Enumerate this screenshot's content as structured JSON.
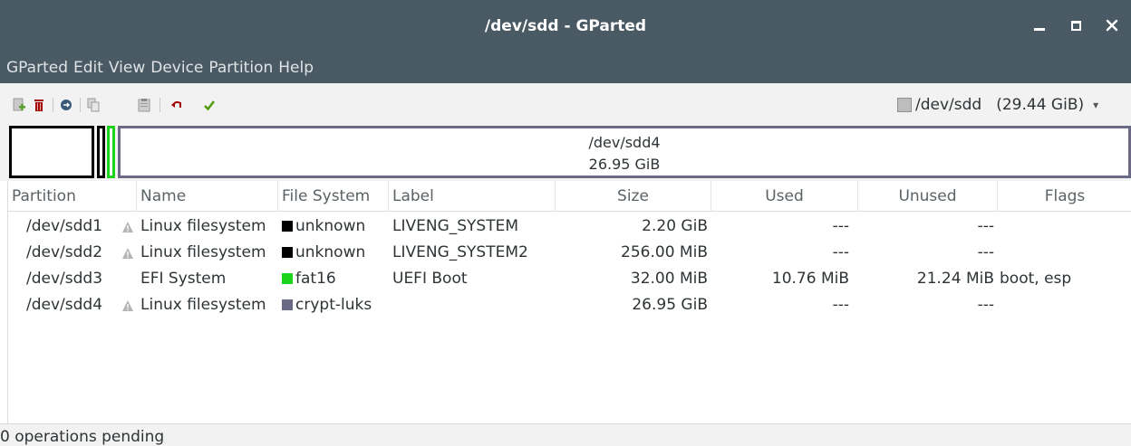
{
  "window": {
    "title": "/dev/sdd - GParted",
    "minimize": "_",
    "maximize": "□",
    "close": "×"
  },
  "menu": [
    "GParted",
    "Edit",
    "View",
    "Device",
    "Partition",
    "Help"
  ],
  "toolbar": {
    "icons": [
      "new-partition-icon",
      "delete-icon",
      "resize-move-icon",
      "copy-icon",
      "paste-icon",
      "undo-icon",
      "apply-icon"
    ],
    "device": "/dev/sdd",
    "device_size": "(29.44 GiB)",
    "dropdown_arrow": "▾"
  },
  "diskmap": {
    "selected_name": "/dev/sdd4",
    "selected_size": "26.95 GiB"
  },
  "columns": [
    "Partition",
    "Name",
    "File System",
    "Label",
    "Size",
    "Used",
    "Unused",
    "Flags"
  ],
  "rows": [
    {
      "partition": "/dev/sdd1",
      "warning": true,
      "name": "Linux filesystem",
      "fs_color": "#000000",
      "fs": "unknown",
      "label": "LIVENG_SYSTEM",
      "size": "2.20 GiB",
      "used": "---",
      "unused": "---",
      "flags": ""
    },
    {
      "partition": "/dev/sdd2",
      "warning": true,
      "name": "Linux filesystem",
      "fs_color": "#000000",
      "fs": "unknown",
      "label": "LIVENG_SYSTEM2",
      "size": "256.00 MiB",
      "used": "---",
      "unused": "---",
      "flags": ""
    },
    {
      "partition": "/dev/sdd3",
      "warning": false,
      "name": "EFI System",
      "fs_color": "#1bd41b",
      "fs": "fat16",
      "label": "UEFI Boot",
      "size": "32.00 MiB",
      "used": "10.76 MiB",
      "unused": "21.24 MiB",
      "flags": "boot, esp"
    },
    {
      "partition": "/dev/sdd4",
      "warning": true,
      "name": "Linux filesystem",
      "fs_color": "#6b6a86",
      "fs": "crypt-luks",
      "label": "",
      "size": "26.95 GiB",
      "used": "---",
      "unused": "---",
      "flags": ""
    }
  ],
  "status": "0 operations pending"
}
